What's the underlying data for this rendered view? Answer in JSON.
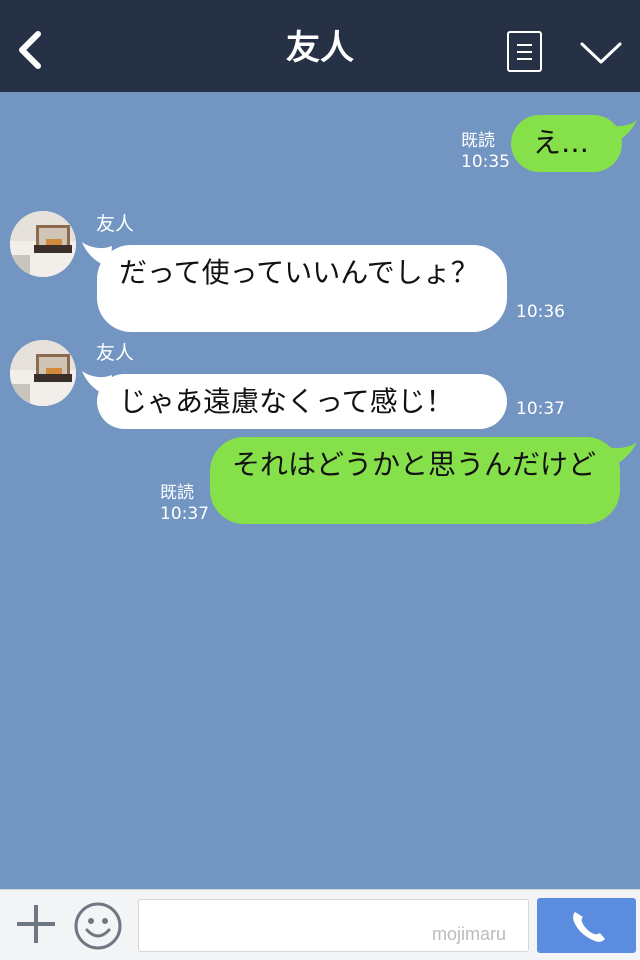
{
  "header": {
    "title": "友人",
    "back_icon": "chevron-left-icon",
    "menu_icon": "list-icon",
    "expand_icon": "chevron-down-icon",
    "background": "#263146"
  },
  "chat": {
    "background": "#7295c2",
    "messages": [
      {
        "direction": "out",
        "text": "え…",
        "read": "既読",
        "time": "10:35"
      },
      {
        "direction": "in",
        "sender": "友人",
        "text": "だって使っていいんでしょ？",
        "time": "10:36"
      },
      {
        "direction": "in",
        "sender": "友人",
        "text": "じゃあ遠慮なくって感じ！",
        "time": "10:37"
      },
      {
        "direction": "out",
        "text": "それはどうかと思うんだけど",
        "read": "既読",
        "time": "10:37"
      }
    ]
  },
  "footer": {
    "plus_icon": "plus-icon",
    "emoji_icon": "smiley-icon",
    "input_value": "",
    "watermark": "mojimaru",
    "call_icon": "phone-icon",
    "call_color": "#5b8cdf"
  },
  "colors": {
    "outgoing_bubble": "#86e04a",
    "incoming_bubble": "#ffffff"
  }
}
